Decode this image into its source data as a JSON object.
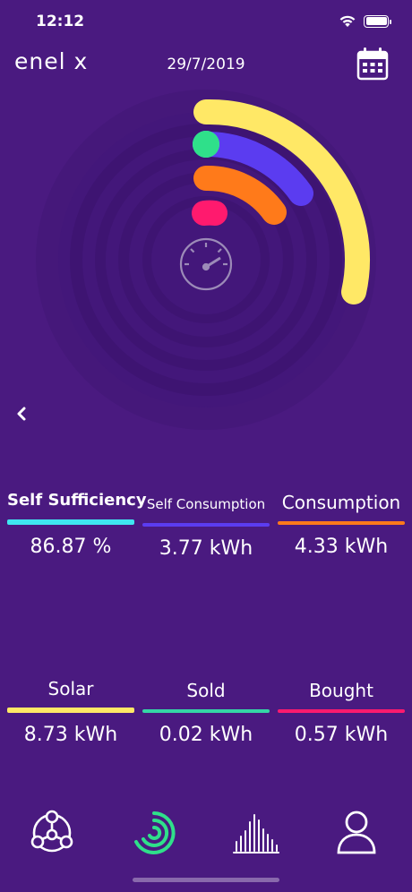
{
  "status_bar": {
    "time": "12:12"
  },
  "header": {
    "logo": "enel x",
    "date": "29/7/2019"
  },
  "colors": {
    "background": "#4a1a80",
    "self_sufficiency": "#3fe6f0",
    "self_consumption": "#5b3cf0",
    "consumption": "#ff7a1a",
    "solar": "#ffe866",
    "sold": "#35d6a6",
    "bought": "#ff1a6e",
    "tab_active": "#2fe08a"
  },
  "stats": [
    {
      "label": "Self Sufficiency",
      "value": "86.87 %"
    },
    {
      "label": "Self Consumption",
      "value": "3.77 kWh"
    },
    {
      "label": "Consumption",
      "value": "4.33 kWh"
    },
    {
      "label": "Solar",
      "value": "8.73 kWh"
    },
    {
      "label": "Sold",
      "value": "0.02 kWh"
    },
    {
      "label": "Bought",
      "value": "0.57 kWh"
    }
  ],
  "icons": {
    "calendar": "calendar-icon",
    "back": "chevron-left-icon",
    "gauge": "speedometer-icon",
    "tabs": [
      "community-icon",
      "energy-ring-icon",
      "bar-chart-icon",
      "user-icon"
    ]
  }
}
